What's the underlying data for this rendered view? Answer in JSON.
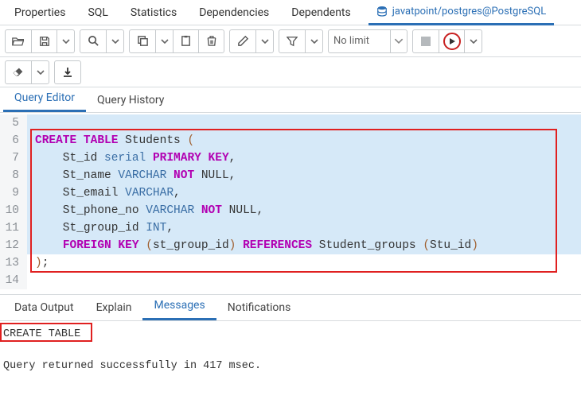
{
  "top_tabs": {
    "properties": "Properties",
    "sql": "SQL",
    "statistics": "Statistics",
    "dependencies": "Dependencies",
    "dependents": "Dependents"
  },
  "connection": "javatpoint/postgres@PostgreSQL",
  "toolbar": {
    "no_limit": "No limit"
  },
  "editor_tabs": {
    "query_editor": "Query Editor",
    "query_history": "Query History"
  },
  "code": {
    "lines": [
      {
        "n": "5",
        "sel": true,
        "html": ""
      },
      {
        "n": "6",
        "sel": true,
        "html": "<span class='kw'>CREATE TABLE</span> Students <span class='paren'>(</span>"
      },
      {
        "n": "7",
        "sel": true,
        "html": "    St_id <span class='dt'>serial</span> <span class='kw'>PRIMARY KEY</span>,"
      },
      {
        "n": "8",
        "sel": true,
        "html": "    St_name <span class='dt'>VARCHAR</span> <span class='kw'>NOT</span> NULL,"
      },
      {
        "n": "9",
        "sel": true,
        "html": "    St_email <span class='dt'>VARCHAR</span>,"
      },
      {
        "n": "10",
        "sel": true,
        "html": "    St_phone_no <span class='dt'>VARCHAR</span> <span class='kw'>NOT</span> NULL,"
      },
      {
        "n": "11",
        "sel": true,
        "html": "    St_group_id <span class='dt'>INT</span>,"
      },
      {
        "n": "12",
        "sel": true,
        "html": "    <span class='kw'>FOREIGN KEY</span> <span class='paren'>(</span>st_group_id<span class='paren'>)</span> <span class='kw'>REFERENCES</span> Student_groups <span class='paren'>(</span>Stu_id<span class='paren'>)</span>"
      },
      {
        "n": "13",
        "sel": false,
        "html": "<span class='paren'>)</span>;"
      },
      {
        "n": "14",
        "sel": false,
        "html": ""
      }
    ]
  },
  "output_tabs": {
    "data_output": "Data Output",
    "explain": "Explain",
    "messages": "Messages",
    "notifications": "Notifications"
  },
  "messages": {
    "line1": "CREATE TABLE",
    "line2": "Query returned successfully in 417 msec."
  }
}
